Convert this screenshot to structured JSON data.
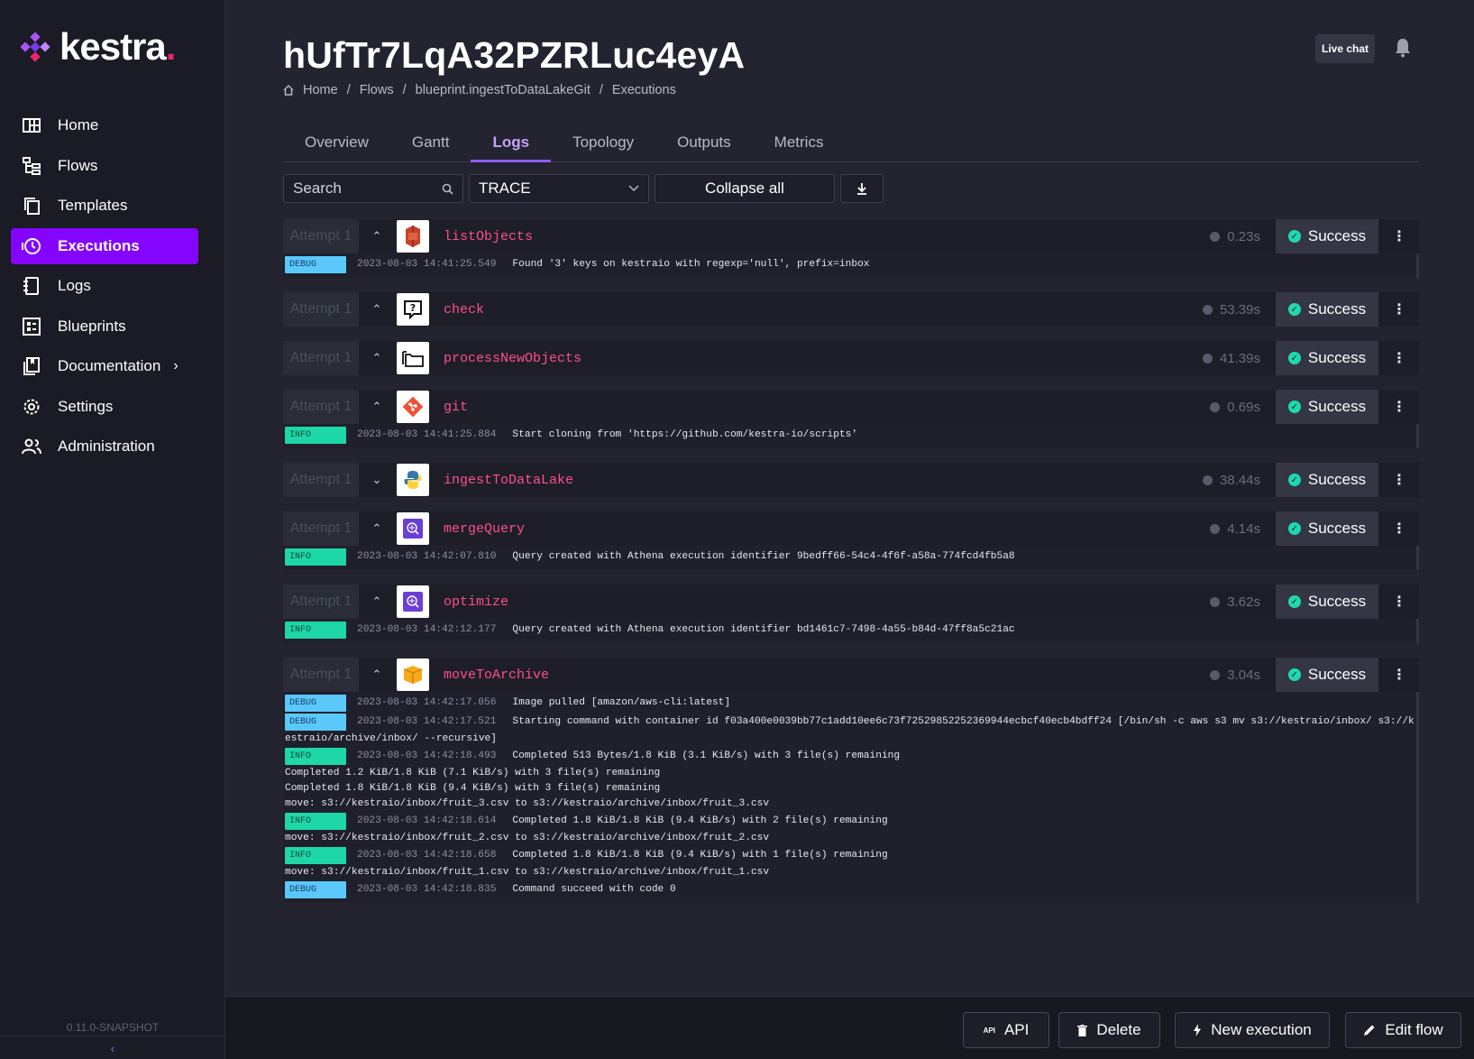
{
  "app": {
    "logo_text": "kestra",
    "version": "0.11.0-SNAPSHOT",
    "collapse_icon": "chevron-left-icon"
  },
  "sidebar": {
    "items": [
      {
        "label": "Home",
        "icon": "home-grid-icon",
        "active": false
      },
      {
        "label": "Flows",
        "icon": "flows-icon",
        "active": false
      },
      {
        "label": "Templates",
        "icon": "templates-icon",
        "active": false
      },
      {
        "label": "Executions",
        "icon": "executions-history-icon",
        "active": true
      },
      {
        "label": "Logs",
        "icon": "logs-icon",
        "active": false
      },
      {
        "label": "Blueprints",
        "icon": "blueprints-icon",
        "active": false
      },
      {
        "label": "Documentation",
        "icon": "documentation-icon",
        "active": false,
        "chevron": "›"
      },
      {
        "label": "Settings",
        "icon": "settings-gear-icon",
        "active": false
      },
      {
        "label": "Administration",
        "icon": "administration-users-icon",
        "active": false
      }
    ]
  },
  "header": {
    "title": "hUfTr7LqA32PZRLuc4eyA",
    "breadcrumb": [
      "Home",
      "Flows",
      "blueprint.ingestToDataLakeGit",
      "Executions"
    ],
    "separator": "/",
    "live_chat": "Live chat"
  },
  "tabs": [
    {
      "label": "Overview",
      "active": false
    },
    {
      "label": "Gantt",
      "active": false
    },
    {
      "label": "Logs",
      "active": true
    },
    {
      "label": "Topology",
      "active": false
    },
    {
      "label": "Outputs",
      "active": false
    },
    {
      "label": "Metrics",
      "active": false
    }
  ],
  "toolbar": {
    "search_placeholder": "Search",
    "level_value": "TRACE",
    "collapse_label": "Collapse all"
  },
  "tasks": [
    {
      "attempt": "Attempt 1",
      "name": "listObjects",
      "duration": "0.23s",
      "status": "Success",
      "toggle": "⌃",
      "icon": "aws-s3-icon",
      "logs": [
        {
          "level": "DEBUG",
          "ts": "2023-08-03 14:41:25.549",
          "msg": "Found '3' keys on kestraio with regexp='null', prefix=inbox"
        }
      ]
    },
    {
      "attempt": "Attempt 1",
      "name": "check",
      "duration": "53.39s",
      "status": "Success",
      "toggle": "⌃",
      "icon": "question-message-icon",
      "logs": []
    },
    {
      "attempt": "Attempt 1",
      "name": "processNewObjects",
      "duration": "41.39s",
      "status": "Success",
      "toggle": "⌃",
      "icon": "folders-icon",
      "logs": []
    },
    {
      "attempt": "Attempt 1",
      "name": "git",
      "duration": "0.69s",
      "status": "Success",
      "toggle": "⌃",
      "icon": "git-icon",
      "logs": [
        {
          "level": "INFO",
          "ts": "2023-08-03 14:41:25.884",
          "msg": "Start cloning from 'https://github.com/kestra-io/scripts'"
        }
      ]
    },
    {
      "attempt": "Attempt 1",
      "name": "ingestToDataLake",
      "duration": "38.44s",
      "status": "Success",
      "toggle": "⌄",
      "icon": "python-icon",
      "logs": []
    },
    {
      "attempt": "Attempt 1",
      "name": "mergeQuery",
      "duration": "4.14s",
      "status": "Success",
      "toggle": "⌃",
      "icon": "aws-athena-icon",
      "logs": [
        {
          "level": "INFO",
          "ts": "2023-08-03 14:42:07.810",
          "msg": "Query created with Athena execution identifier 9bedff66-54c4-4f6f-a58a-774fcd4fb5a8"
        }
      ]
    },
    {
      "attempt": "Attempt 1",
      "name": "optimize",
      "duration": "3.62s",
      "status": "Success",
      "toggle": "⌃",
      "icon": "aws-athena-icon",
      "logs": [
        {
          "level": "INFO",
          "ts": "2023-08-03 14:42:12.177",
          "msg": "Query created with Athena execution identifier bd1461c7-7498-4a55-b84d-47ff8a5c21ac"
        }
      ]
    },
    {
      "attempt": "Attempt 1",
      "name": "moveToArchive",
      "duration": "3.04s",
      "status": "Success",
      "toggle": "⌃",
      "icon": "aws-cli-box-icon",
      "logs": [
        {
          "level": "DEBUG",
          "ts": "2023-08-03 14:42:17.056",
          "msg": "Image pulled [amazon/aws-cli:latest]"
        },
        {
          "level": "DEBUG",
          "ts": "2023-08-03 14:42:17.521",
          "msg": "Starting command with container id f03a400e0039bb77c1add10ee6c73f72529852252369944ecbcf40ecb4bdff24 [/bin/sh -c aws s3 mv s3://kestraio/inbox/ s3://k",
          "wrap": "estraio/archive/inbox/ --recursive]"
        },
        {
          "level": "INFO",
          "ts": "2023-08-03 14:42:18.493",
          "msg": "Completed 513 Bytes/1.8 KiB (3.1 KiB/s) with 3 file(s) remaining",
          "wrap": "Completed 1.2 KiB/1.8 KiB (7.1 KiB/s) with 3 file(s) remaining\nCompleted 1.8 KiB/1.8 KiB (9.4 KiB/s) with 3 file(s) remaining\nmove: s3://kestraio/inbox/fruit_3.csv to s3://kestraio/archive/inbox/fruit_3.csv"
        },
        {
          "level": "INFO",
          "ts": "2023-08-03 14:42:18.614",
          "msg": "Completed 1.8 KiB/1.8 KiB (9.4 KiB/s) with 2 file(s) remaining",
          "wrap": "move: s3://kestraio/inbox/fruit_2.csv to s3://kestraio/archive/inbox/fruit_2.csv"
        },
        {
          "level": "INFO",
          "ts": "2023-08-03 14:42:18.658",
          "msg": "Completed 1.8 KiB/1.8 KiB (9.4 KiB/s) with 1 file(s) remaining",
          "wrap": "move: s3://kestraio/inbox/fruit_1.csv to s3://kestraio/archive/inbox/fruit_1.csv"
        },
        {
          "level": "DEBUG",
          "ts": "2023-08-03 14:42:18.835",
          "msg": "Command succeed with code 0"
        }
      ]
    }
  ],
  "footer": {
    "api": "API",
    "api_icon_text": "API",
    "delete": "Delete",
    "new_execution": "New execution",
    "edit_flow": "Edit flow"
  },
  "colors": {
    "accent": "#8405ff",
    "task_name": "#ff4d8d",
    "success": "#1fd8b0",
    "debug_badge": "#5ac8fa",
    "info_badge": "#1ed7a8"
  }
}
